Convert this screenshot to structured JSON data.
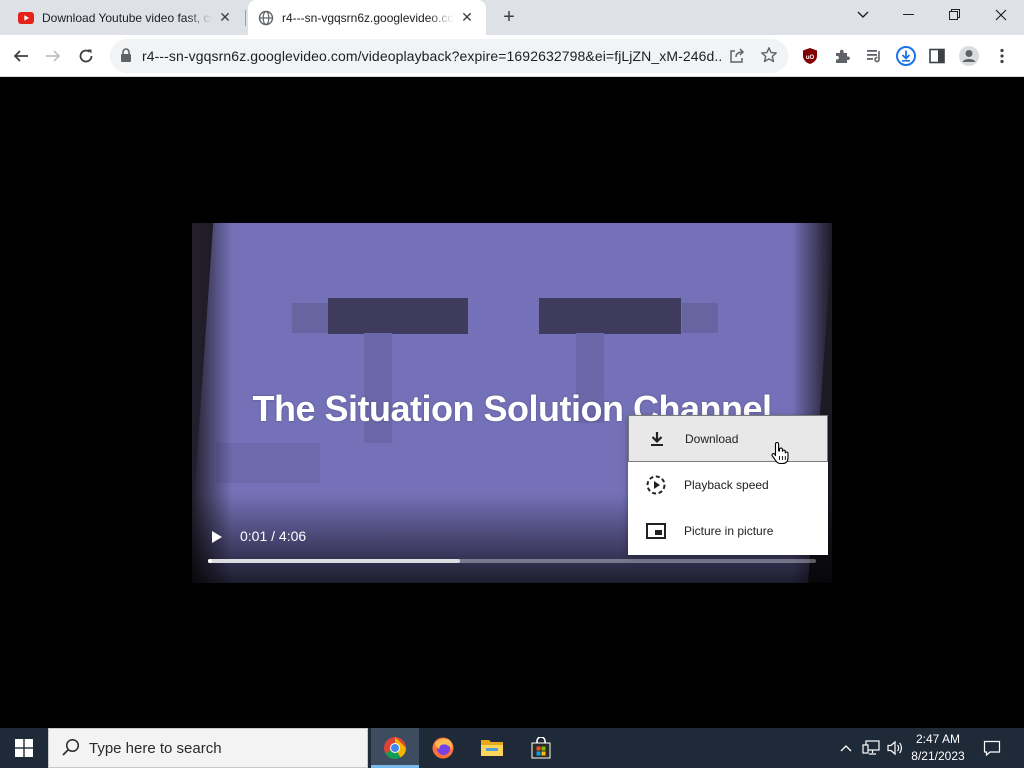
{
  "browser": {
    "tabs": [
      {
        "title": "Download Youtube video fast, co",
        "favicon": "youtube-icon"
      },
      {
        "title": "r4---sn-vgqsrn6z.googlevideo.cc",
        "favicon": "globe-icon"
      }
    ],
    "url": "r4---sn-vgqsrn6z.googlevideo.com/videoplayback?expire=1692632798&ei=fjLjZN_xM-246d...",
    "accent": "#1a73e8"
  },
  "video": {
    "overlay_title": "The Situation Solution Channel",
    "current_time": "0:01",
    "duration": "4:06",
    "time_display": "0:01 / 4:06",
    "played_fraction": 0.004,
    "buffered_fraction": 0.415
  },
  "context_menu": {
    "items": [
      {
        "label": "Download",
        "icon": "download-icon",
        "highlighted": true
      },
      {
        "label": "Playback speed",
        "icon": "playback-speed-icon"
      },
      {
        "label": "Picture in picture",
        "icon": "picture-in-picture-icon"
      }
    ]
  },
  "taskbar": {
    "search_placeholder": "Type here to search",
    "apps": [
      "chrome-icon",
      "firefox-icon",
      "file-explorer-icon",
      "store-icon"
    ],
    "time": "2:47 AM",
    "date": "8/21/2023"
  }
}
